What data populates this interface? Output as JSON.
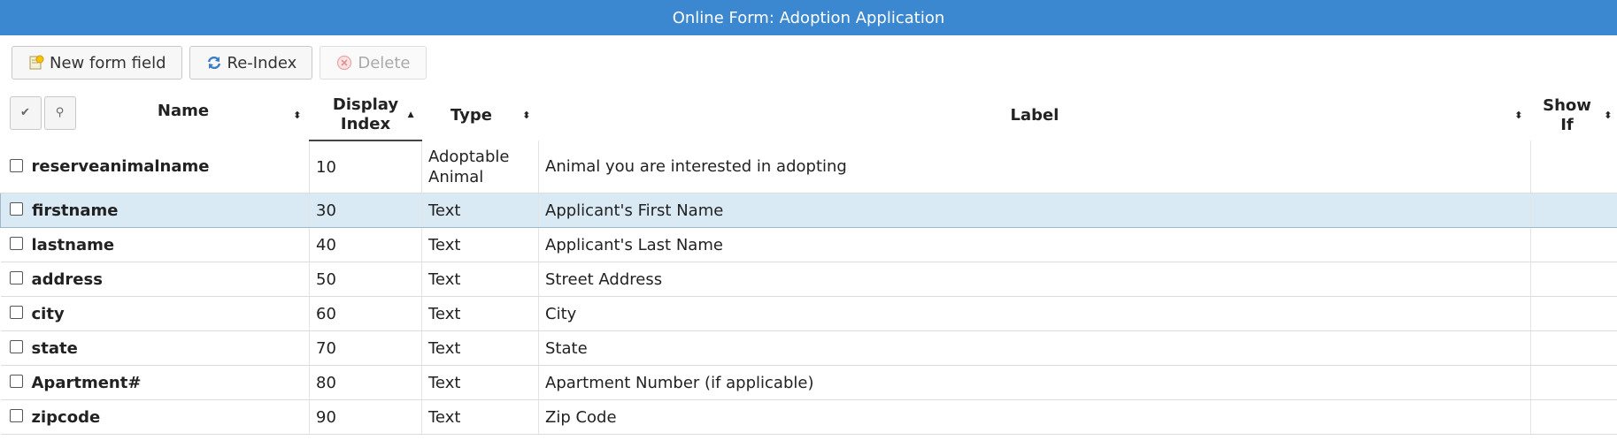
{
  "window": {
    "title": "Online Form: Adoption Application"
  },
  "toolbar": {
    "new_label": "New form field",
    "reindex_label": "Re-Index",
    "delete_label": "Delete"
  },
  "table": {
    "columns": {
      "name": "Name",
      "display_index_1": "Display",
      "display_index_2": "Index",
      "type": "Type",
      "label": "Label",
      "show_if_1": "Show",
      "show_if_2": "If"
    },
    "header_buttons": {
      "check_glyph": "✔",
      "search_glyph": "⚲"
    },
    "sort_both": "⬍",
    "sort_asc": "▲",
    "rows": [
      {
        "name": "reserveanimalname",
        "index": "10",
        "type_1": "Adoptable",
        "type_2": "Animal",
        "label": "Animal you are interested in adopting",
        "show_if": ""
      },
      {
        "name": "firstname",
        "index": "30",
        "type": "Text",
        "label": "Applicant's First Name",
        "show_if": ""
      },
      {
        "name": "lastname",
        "index": "40",
        "type": "Text",
        "label": "Applicant's Last Name",
        "show_if": ""
      },
      {
        "name": "address",
        "index": "50",
        "type": "Text",
        "label": "Street Address",
        "show_if": ""
      },
      {
        "name": "city",
        "index": "60",
        "type": "Text",
        "label": "City",
        "show_if": ""
      },
      {
        "name": "state",
        "index": "70",
        "type": "Text",
        "label": "State",
        "show_if": ""
      },
      {
        "name": "Apartment#",
        "index": "80",
        "type": "Text",
        "label": "Apartment Number (if applicable)",
        "show_if": ""
      },
      {
        "name": "zipcode",
        "index": "90",
        "type": "Text",
        "label": "Zip Code",
        "show_if": ""
      }
    ]
  },
  "colors": {
    "titlebar": "#3b88d1",
    "selected_row": "#daeaf5"
  },
  "icons": [
    "new-field-icon",
    "reindex-icon",
    "delete-icon",
    "checkmark-icon",
    "search-icon",
    "sort-icon"
  ]
}
